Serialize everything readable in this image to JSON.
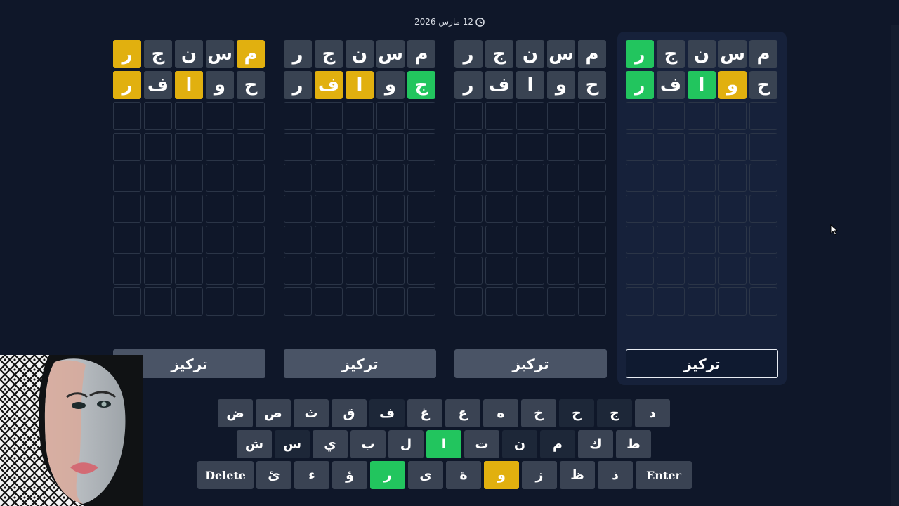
{
  "header": {
    "date": "12 مارس 2026",
    "icon": "clock-icon"
  },
  "boards": [
    {
      "active": false,
      "rows": [
        [
          {
            "l": "م",
            "s": "present"
          },
          {
            "l": "س",
            "s": "filled"
          },
          {
            "l": "ن",
            "s": "filled"
          },
          {
            "l": "ج",
            "s": "filled"
          },
          {
            "l": "ر",
            "s": "present"
          }
        ],
        [
          {
            "l": "ح",
            "s": "filled"
          },
          {
            "l": "و",
            "s": "filled"
          },
          {
            "l": "ا",
            "s": "present"
          },
          {
            "l": "ف",
            "s": "filled"
          },
          {
            "l": "ر",
            "s": "present"
          }
        ]
      ],
      "focus_label": "تركيز"
    },
    {
      "active": false,
      "rows": [
        [
          {
            "l": "م",
            "s": "filled"
          },
          {
            "l": "س",
            "s": "filled"
          },
          {
            "l": "ن",
            "s": "filled"
          },
          {
            "l": "ج",
            "s": "filled"
          },
          {
            "l": "ر",
            "s": "filled"
          }
        ],
        [
          {
            "l": "ج",
            "s": "correct"
          },
          {
            "l": "و",
            "s": "filled"
          },
          {
            "l": "ا",
            "s": "present"
          },
          {
            "l": "ف",
            "s": "present"
          },
          {
            "l": "ر",
            "s": "filled"
          }
        ]
      ],
      "focus_label": "تركيز"
    },
    {
      "active": false,
      "rows": [
        [
          {
            "l": "م",
            "s": "filled"
          },
          {
            "l": "س",
            "s": "filled"
          },
          {
            "l": "ن",
            "s": "filled"
          },
          {
            "l": "ج",
            "s": "filled"
          },
          {
            "l": "ر",
            "s": "filled"
          }
        ],
        [
          {
            "l": "ح",
            "s": "filled"
          },
          {
            "l": "و",
            "s": "filled"
          },
          {
            "l": "ا",
            "s": "filled"
          },
          {
            "l": "ف",
            "s": "filled"
          },
          {
            "l": "ر",
            "s": "filled"
          }
        ]
      ],
      "focus_label": "تركيز"
    },
    {
      "active": true,
      "rows": [
        [
          {
            "l": "م",
            "s": "filled"
          },
          {
            "l": "س",
            "s": "filled"
          },
          {
            "l": "ن",
            "s": "filled"
          },
          {
            "l": "ج",
            "s": "filled"
          },
          {
            "l": "ر",
            "s": "correct"
          }
        ],
        [
          {
            "l": "ح",
            "s": "filled"
          },
          {
            "l": "و",
            "s": "present"
          },
          {
            "l": "ا",
            "s": "correct"
          },
          {
            "l": "ف",
            "s": "filled"
          },
          {
            "l": "ر",
            "s": "correct"
          }
        ]
      ],
      "focus_label": "تركيز"
    }
  ],
  "keyboard": {
    "rows": [
      [
        {
          "k": "د",
          "s": "filled"
        },
        {
          "k": "ج",
          "s": "dark"
        },
        {
          "k": "ح",
          "s": "dark"
        },
        {
          "k": "خ",
          "s": "filled"
        },
        {
          "k": "ه",
          "s": "filled"
        },
        {
          "k": "ع",
          "s": "filled"
        },
        {
          "k": "غ",
          "s": "filled"
        },
        {
          "k": "ف",
          "s": "dark"
        },
        {
          "k": "ق",
          "s": "filled"
        },
        {
          "k": "ث",
          "s": "filled"
        },
        {
          "k": "ص",
          "s": "filled"
        },
        {
          "k": "ض",
          "s": "filled"
        }
      ],
      [
        {
          "k": "ط",
          "s": "filled"
        },
        {
          "k": "ك",
          "s": "filled"
        },
        {
          "k": "م",
          "s": "dark"
        },
        {
          "k": "ن",
          "s": "dark"
        },
        {
          "k": "ت",
          "s": "filled"
        },
        {
          "k": "ا",
          "s": "correct"
        },
        {
          "k": "ل",
          "s": "filled"
        },
        {
          "k": "ب",
          "s": "filled"
        },
        {
          "k": "ي",
          "s": "filled"
        },
        {
          "k": "س",
          "s": "dark"
        },
        {
          "k": "ش",
          "s": "filled"
        }
      ],
      [
        {
          "k": "Enter",
          "s": "filled",
          "wide": true
        },
        {
          "k": "ذ",
          "s": "filled"
        },
        {
          "k": "ظ",
          "s": "filled"
        },
        {
          "k": "ز",
          "s": "filled"
        },
        {
          "k": "و",
          "s": "present"
        },
        {
          "k": "ة",
          "s": "filled"
        },
        {
          "k": "ى",
          "s": "filled"
        },
        {
          "k": "ر",
          "s": "correct"
        },
        {
          "k": "ؤ",
          "s": "filled"
        },
        {
          "k": "ء",
          "s": "filled"
        },
        {
          "k": "ئ",
          "s": "filled"
        },
        {
          "k": "Delete",
          "s": "filled",
          "wide": true
        }
      ]
    ]
  },
  "colors": {
    "background": "#0f1729",
    "correct": "#22c55e",
    "present": "#e1b00f",
    "filled": "#394352"
  }
}
